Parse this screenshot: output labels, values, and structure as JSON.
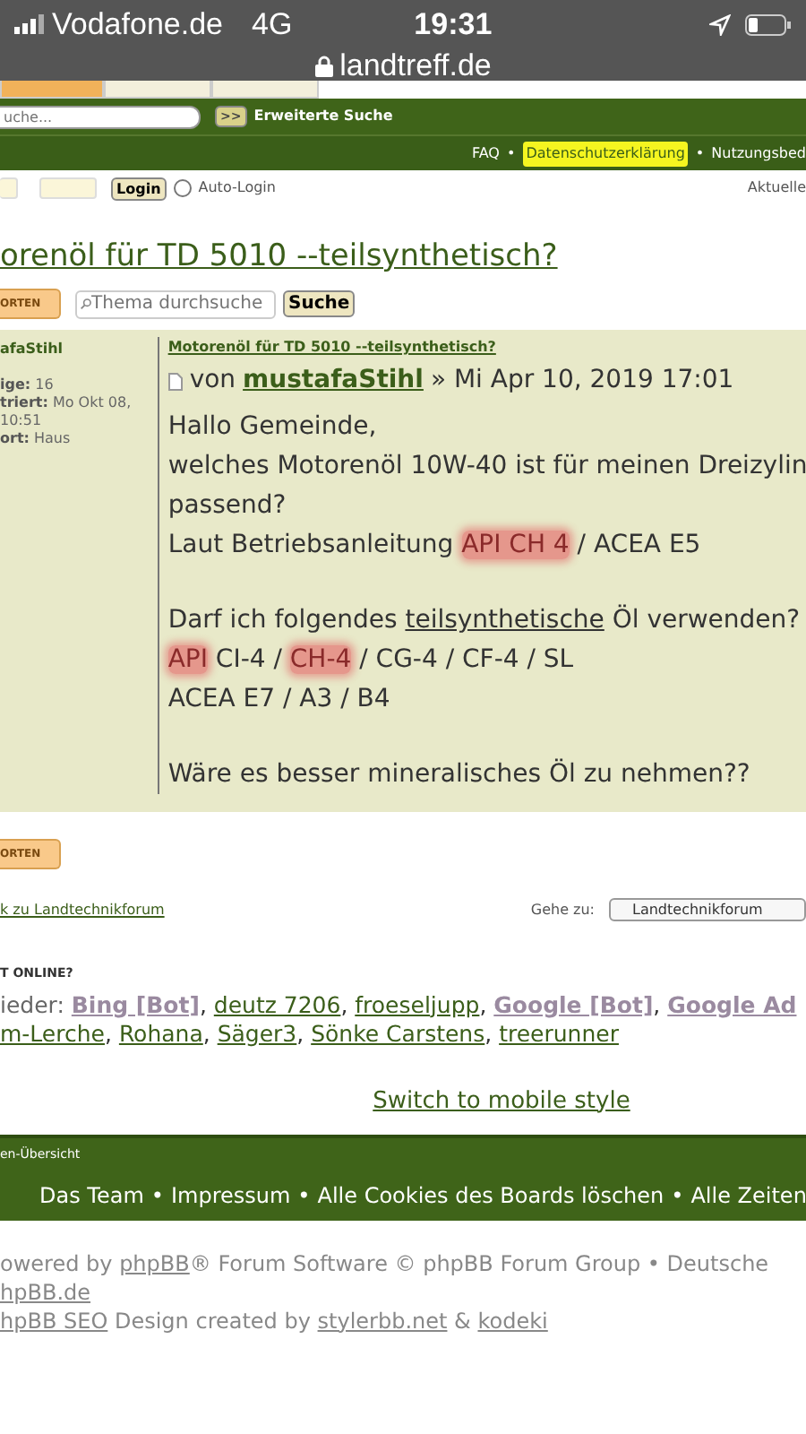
{
  "status_bar": {
    "carrier": "Vodafone.de",
    "network": "4G",
    "time": "19:31",
    "url": "landtreff.de"
  },
  "tabs": [
    {
      "selected": true
    },
    {
      "selected": false
    },
    {
      "selected": false
    }
  ],
  "search": {
    "placeholder": "uche...",
    "go": ">>",
    "advanced": "Erweiterte Suche"
  },
  "top_links": {
    "separator": "•",
    "items": [
      {
        "label": "FAQ",
        "highlighted": false
      },
      {
        "label": "Datenschutzerklärung",
        "highlighted": true
      },
      {
        "label": "Nutzungsbed",
        "highlighted": false
      }
    ]
  },
  "login": {
    "button": "Login",
    "auto_login": {
      "label": "Auto-Login",
      "checked": false
    },
    "right_link": "Aktuelle"
  },
  "topic_title": "orenöl für TD 5010 --teilsynthetisch?",
  "reply_button": "ORTEN",
  "topic_search": {
    "placeholder": "Thema durchsuche",
    "button": "Suche"
  },
  "post": {
    "author": "afaStihl",
    "profile": [
      {
        "label": "ige:",
        "value": "16"
      },
      {
        "label": "triert:",
        "value": "Mo Okt 08, 10:51"
      },
      {
        "label": "ort:",
        "value": "Haus"
      }
    ],
    "subject": "Motorenöl für TD 5010 --teilsynthetisch?",
    "by": "von",
    "by_user": "mustafaStihl",
    "date": "» Mi Apr 10, 2019 17:01",
    "paragraphs": [
      [
        [
          {
            "text": "Hallo Gemeinde,",
            "kind": "plain"
          }
        ],
        [
          {
            "text": "welches Motorenöl 10W-40 ist für meinen Dreizylin",
            "kind": "plain"
          }
        ],
        [
          {
            "text": "passend?",
            "kind": "plain"
          }
        ],
        [
          {
            "text": "Laut Betriebsanleitung ",
            "kind": "plain"
          },
          {
            "text": "API CH 4",
            "kind": "highlight"
          },
          {
            "text": " / ACEA E5",
            "kind": "plain"
          }
        ]
      ],
      [
        [
          {
            "text": "Darf ich folgendes ",
            "kind": "plain"
          },
          {
            "text": "teilsynthetische",
            "kind": "underline"
          },
          {
            "text": " Öl verwenden?",
            "kind": "plain"
          }
        ],
        [
          {
            "text": "API",
            "kind": "highlight"
          },
          {
            "text": " CI-4 / ",
            "kind": "plain"
          },
          {
            "text": "CH-4",
            "kind": "highlight"
          },
          {
            "text": " / CG-4 / CF-4 / SL",
            "kind": "plain"
          }
        ],
        [
          {
            "text": "ACEA E7 / A3 / B4",
            "kind": "plain"
          }
        ]
      ],
      [
        [
          {
            "text": "Wäre es besser mineralisches Öl zu nehmen??",
            "kind": "plain"
          }
        ]
      ]
    ]
  },
  "bottom_reply_button": "ORTEN",
  "back_link": "k zu Landtechnikforum",
  "jump": {
    "label": "Gehe zu:",
    "value": "Landtechnikforum"
  },
  "online": {
    "heading": "T ONLINE?",
    "prefix": "ieder:",
    "separator": ", ",
    "lines": [
      [
        {
          "name": "Bing [Bot]",
          "kind": "bot"
        },
        {
          "name": "deutz 7206",
          "kind": "user"
        },
        {
          "name": "froeseljupp",
          "kind": "user"
        },
        {
          "name": "Google [Bot]",
          "kind": "bot"
        },
        {
          "name": "Google Ad",
          "kind": "bot"
        }
      ],
      [
        {
          "name": "m-Lerche",
          "kind": "user"
        },
        {
          "name": "Rohana",
          "kind": "user"
        },
        {
          "name": "Säger3",
          "kind": "user"
        },
        {
          "name": "Sönke Carstens",
          "kind": "user"
        },
        {
          "name": "treerunner",
          "kind": "user"
        }
      ]
    ]
  },
  "mobile_link": "Switch to mobile style",
  "footer": {
    "breadcrumb": "en-Übersicht",
    "separator": "•",
    "links": [
      "Das Team",
      "Impressum",
      "Alle Cookies des Boards löschen",
      "Alle Zeiten"
    ],
    "credits": [
      [
        {
          "text": "owered by ",
          "link": false
        },
        {
          "text": "phpBB",
          "link": true
        },
        {
          "text": "® Forum Software © phpBB Forum Group • Deutsche",
          "link": false
        }
      ],
      [
        {
          "text": "hpBB.de",
          "link": true
        }
      ],
      [
        {
          "text": "hpBB SEO",
          "link": true
        },
        {
          "text": " Design created by ",
          "link": false
        },
        {
          "text": "stylerbb.net",
          "link": true
        },
        {
          "text": " & ",
          "link": false
        },
        {
          "text": "kodeki",
          "link": true
        }
      ]
    ]
  }
}
